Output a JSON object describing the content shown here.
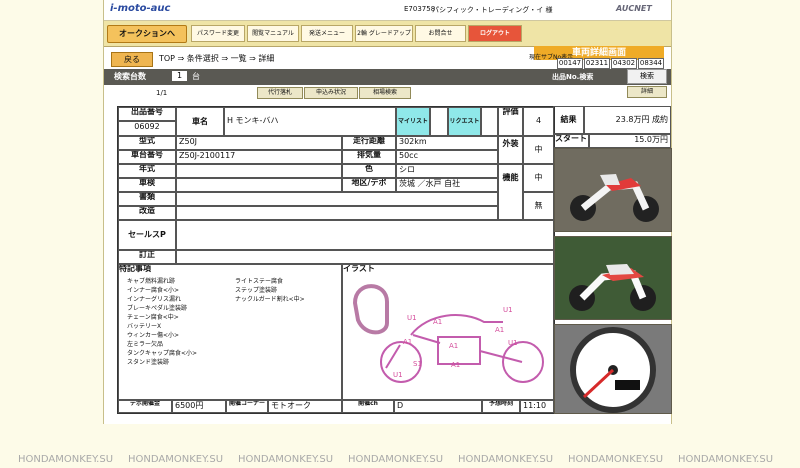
{
  "app": {
    "logo": "i-moto-auc",
    "member_code": "E703758",
    "member_name": "パシフィック・トレーディング・イ 様",
    "brand": "AUCNET"
  },
  "nav": {
    "auction_button": "オークションへ",
    "tabs": [
      "パスワード変更",
      "閲覧マニュアル",
      "発送メニュー",
      "2輪 グレードアップ",
      "お問合せ",
      "ログアウト"
    ],
    "screen_title": "車両詳細画面"
  },
  "counters": {
    "label": "現在サブNo表示",
    "values": [
      "00147",
      "02311",
      "04302",
      "08344"
    ],
    "headers": [
      "B-ch",
      "B-ch",
      "B-ch",
      "B-ch"
    ]
  },
  "breadcrumb": {
    "back": "戻る",
    "path": "TOP ⇒ 条件選択 ⇒ 一覧 ⇒ 詳細"
  },
  "search": {
    "label": "検索台数",
    "count": "1",
    "unit": "台",
    "auction_no_label": "出品No.検索",
    "button": "検索"
  },
  "paging": {
    "text": "1/1",
    "buttons": [
      "代行落札",
      "申込み状況",
      "相場検索"
    ],
    "detail": "詳細"
  },
  "sheet": {
    "labels": {
      "lot": "出品番号",
      "model_name": "車名",
      "mylist": "マイリスト",
      "request": "リクエスト",
      "rating": "評価",
      "result": "結果",
      "type": "型式",
      "mileage": "走行距離",
      "exterior": "外装",
      "start": "スタート",
      "frame": "車台番号",
      "displacement": "排気量",
      "year": "年式",
      "color": "色",
      "engine": "機能",
      "inspection": "車検",
      "region": "地区/デポ",
      "docs": "書類",
      "refine": "改造",
      "sales": "セールスP",
      "correction": "訂正",
      "notes": "特記事項",
      "illustration": "イラスト",
      "sale_price": "デポ開催金",
      "corner": "開催コーナー",
      "venue": "開催ch",
      "schedule": "予想時刻"
    },
    "values": {
      "lot": "06092",
      "model_name": "H モンキ-バハ",
      "rating": "4",
      "result": "23.8万円 成約",
      "type": "Z50J",
      "mileage": "302km",
      "exterior": "中",
      "start": "15.0万円",
      "frame": "Z50J-2100117",
      "displacement": "50cc",
      "color": "シロ",
      "engine": "中",
      "region": "茨城 ／水戸 自社",
      "refine": "無",
      "sale_price": "6500円",
      "corner": "モトオーク",
      "venue": "D",
      "schedule": "11:10"
    },
    "notes_left": [
      "キャブ燃料漏れ跡",
      "インナー腐食<小>",
      "インナーグリス漏れ",
      "ブレーキペダル塗装跡",
      "チェーン腐食<中>",
      "バッテリーX",
      "ウィンカー傷<小>",
      "左ミラー欠品",
      "タンクキャップ腐食<小>",
      "スタンド塗装跡"
    ],
    "notes_right": [
      "ライトステー腐食",
      "ステップ塗装跡",
      "ナックルガード割れ<中>"
    ],
    "illustration_marks": [
      "A1",
      "A1",
      "U1",
      "S1",
      "A1",
      "A1",
      "U1",
      "A1",
      "U1",
      "U1"
    ]
  },
  "photos": {
    "count": 3
  },
  "watermark": "HONDAMONKEY.SU"
}
